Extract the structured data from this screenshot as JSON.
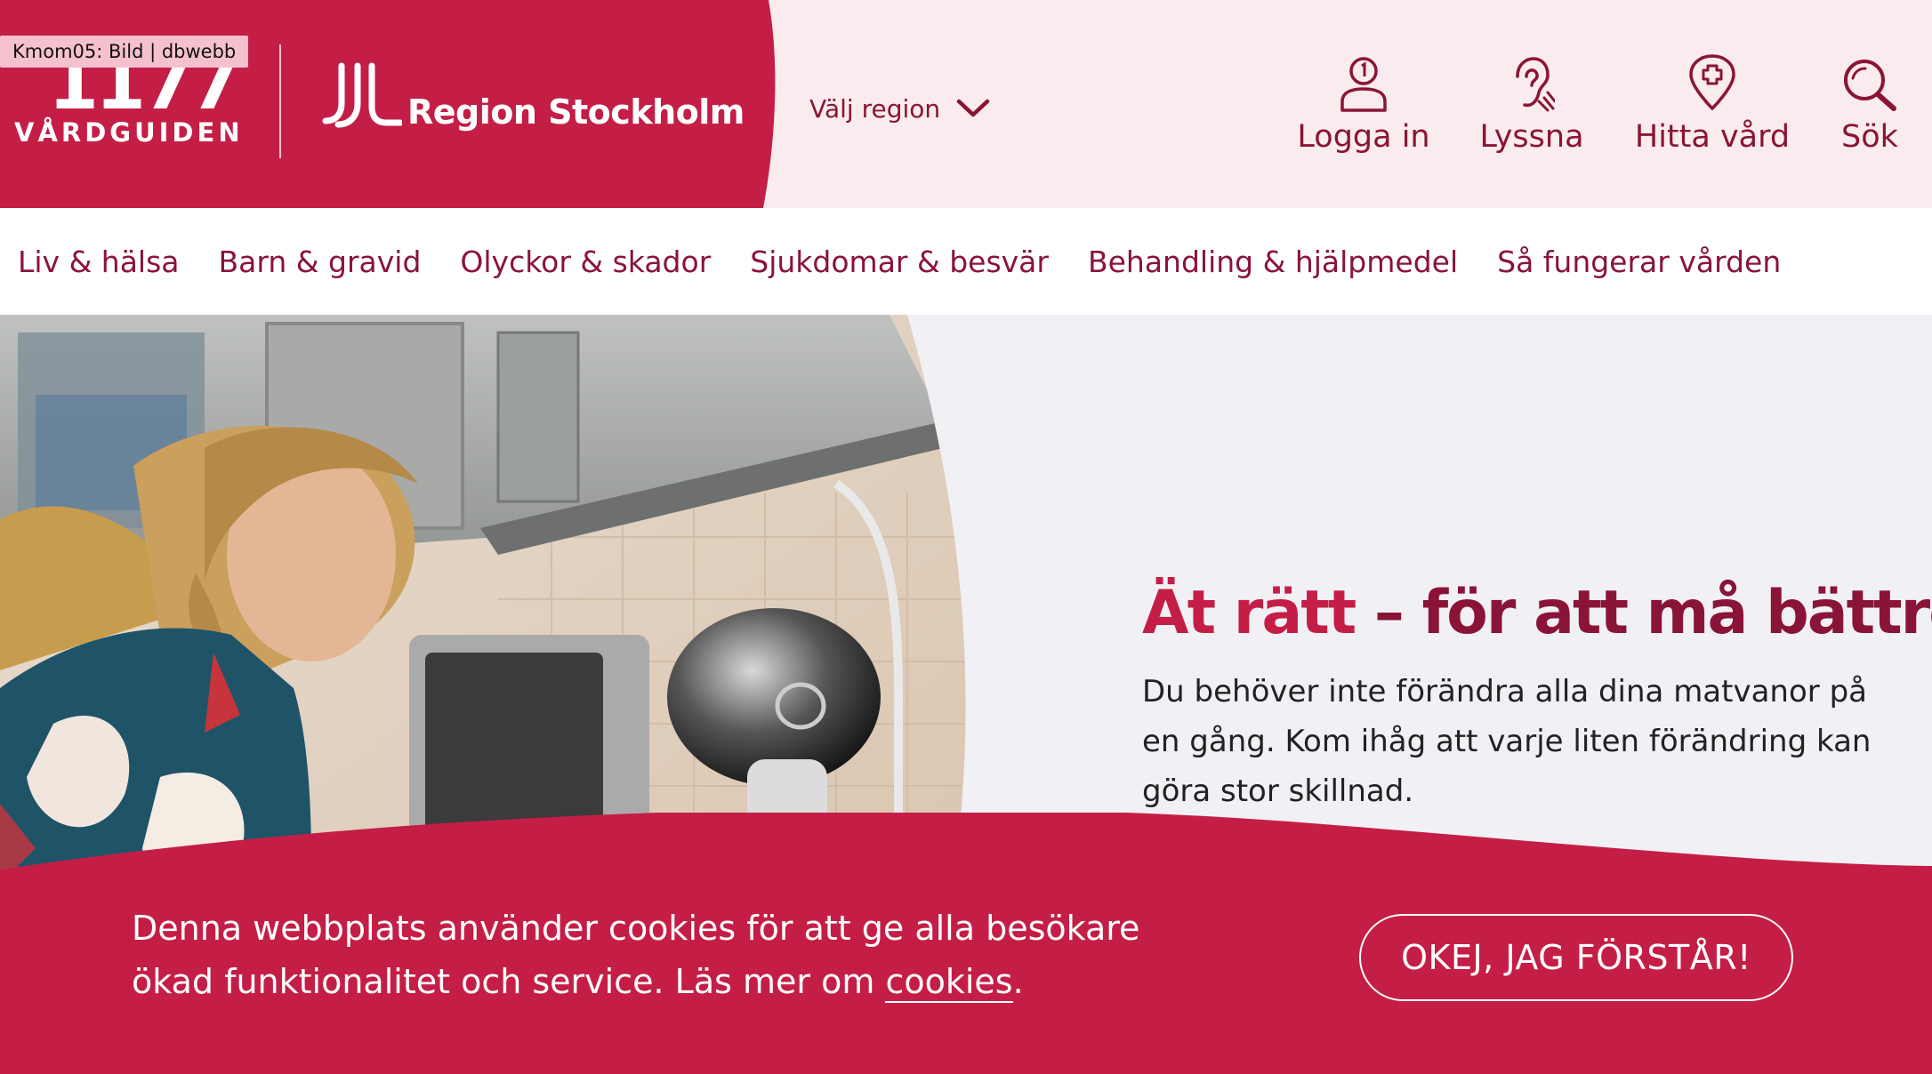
{
  "tooltip": "Kmom05: Bild | dbwebb",
  "brand": {
    "logo_number": "1177",
    "logo_subtitle": "VÅRDGUIDEN",
    "region_name": "Region Stockholm"
  },
  "region_select": {
    "label": "Välj region"
  },
  "tools": [
    {
      "label": "Logga in",
      "icon": "user-icon"
    },
    {
      "label": "Lyssna",
      "icon": "ear-icon"
    },
    {
      "label": "Hitta vård",
      "icon": "map-pin-cross-icon"
    },
    {
      "label": "Sök",
      "icon": "search-icon"
    }
  ],
  "nav": [
    "Liv & hälsa",
    "Barn & gravid",
    "Olyckor & skador",
    "Sjukdomar & besvär",
    "Behandling & hjälpmedel",
    "Så fungerar vården"
  ],
  "hero": {
    "title_part1": "Ät rätt",
    "title_part2": " – för att må bättre",
    "text": "Du behöver inte förändra alla dina matvanor på en gång. Kom ihåg att varje liten förändring kan göra stor skillnad."
  },
  "cookie": {
    "text_before": "Denna webbplats använder cookies för att ge alla besökare ökad funktionalitet och service. Läs mer om ",
    "link": "cookies",
    "text_after": ".",
    "button": "OKEJ, JAG FÖRSTÅR!"
  },
  "colors": {
    "brand_red": "#c41e46",
    "dark_red": "#8a1438",
    "header_tint": "#f9ebee",
    "hero_bg": "#f0f0f5"
  }
}
